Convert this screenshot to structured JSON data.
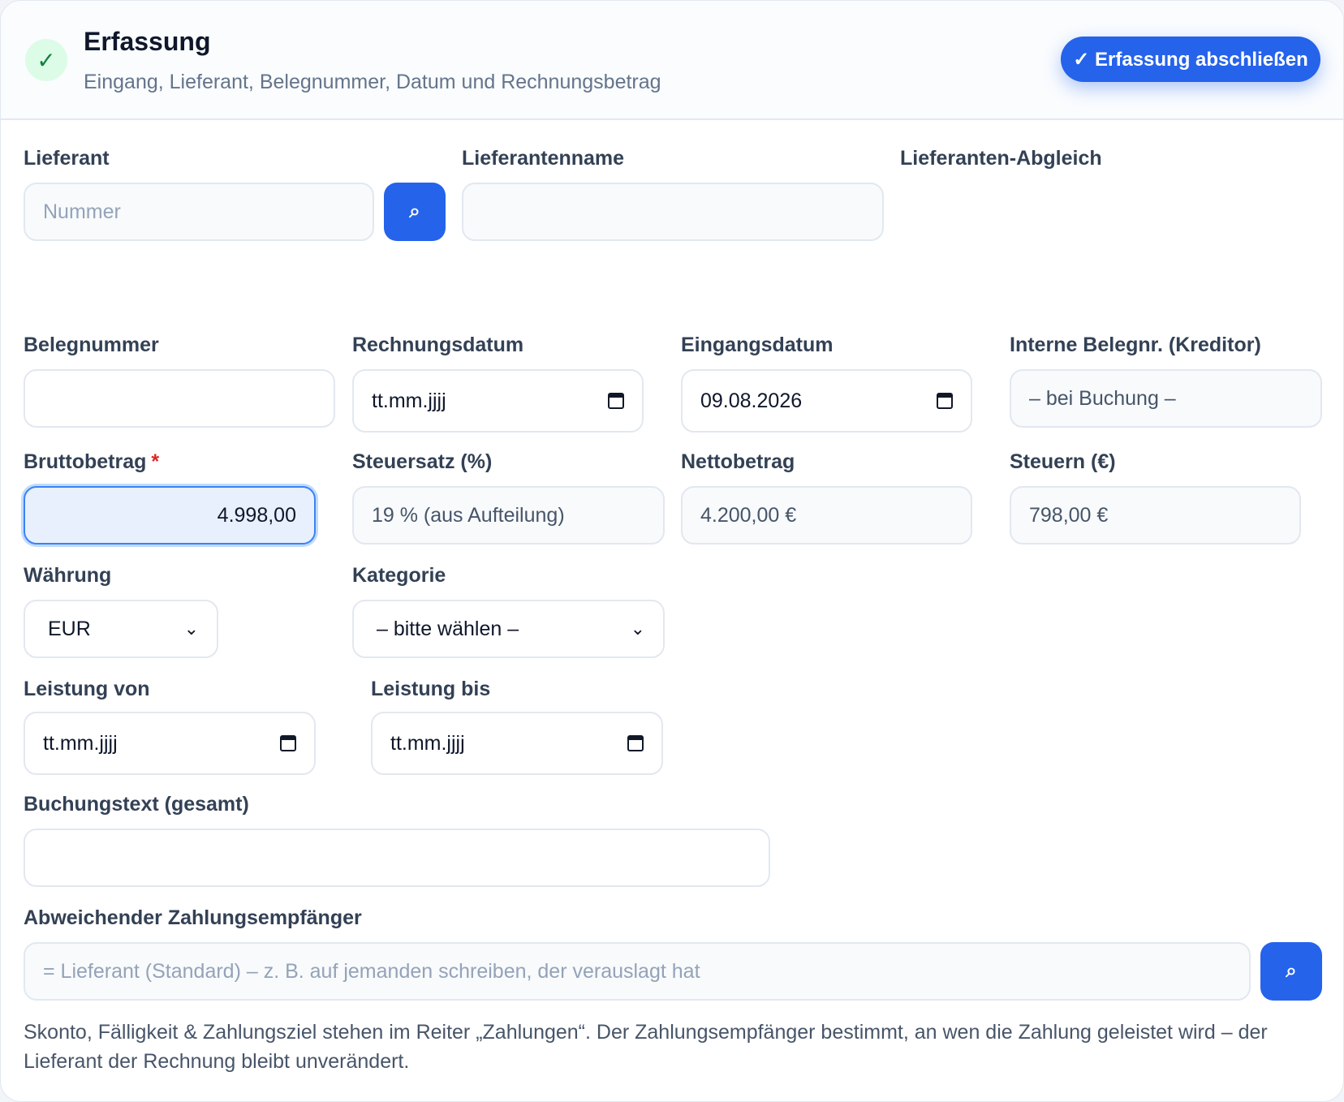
{
  "header": {
    "check_glyph": "✓",
    "title": "Erfassung",
    "subtitle": "Eingang, Lieferant, Belegnummer, Datum und Rechnungsbetrag",
    "primary_button": "✓ Erfassung abschließen"
  },
  "supplier": {
    "label": "Lieferant",
    "number_placeholder": "Nummer",
    "name_label": "Lieferantenname",
    "name_value": "",
    "match_label": "Lieferanten-Abgleich"
  },
  "document": {
    "belegnummer_label": "Belegnummer",
    "belegnummer_value": "",
    "rechnungsdatum_label": "Rechnungsdatum",
    "rechnungsdatum_value": "tt.mm.jjjj",
    "eingangsdatum_label": "Eingangsdatum",
    "eingangsdatum_value": "09.08.2026",
    "interne_label": "Interne Belegnr. (Kreditor)",
    "interne_value": "– bei Buchung –"
  },
  "amounts": {
    "brutto_label": "Bruttobetrag",
    "required_mark": "*",
    "brutto_value": "4.998,00",
    "steuersatz_label": "Steuersatz (%)",
    "steuersatz_value": "19 % (aus Aufteilung)",
    "netto_label": "Nettobetrag",
    "netto_value": "4.200,00 €",
    "steuern_label": "Steuern (€)",
    "steuern_value": "798,00 €"
  },
  "selects": {
    "waehrung_label": "Währung",
    "waehrung_value": "EUR",
    "kategorie_label": "Kategorie",
    "kategorie_value": "– bitte wählen –"
  },
  "service_period": {
    "von_label": "Leistung von",
    "von_value": "tt.mm.jjjj",
    "bis_label": "Leistung bis",
    "bis_value": "tt.mm.jjjj"
  },
  "booking": {
    "text_label": "Buchungstext (gesamt)",
    "text_value": ""
  },
  "payee": {
    "label": "Abweichender Zahlungsempfänger",
    "placeholder": "= Lieferant (Standard) – z. B. auf jemanden schreiben, der verauslagt hat"
  },
  "icons": {
    "search_glyph": "⌕"
  },
  "note": "Skonto, Fälligkeit & Zahlungsziel stehen im Reiter „Zahlungen“. Der Zahlungsempfänger bestimmt, an wen die Zahlung geleistet wird – der Lieferant der Rechnung bleibt unverändert."
}
